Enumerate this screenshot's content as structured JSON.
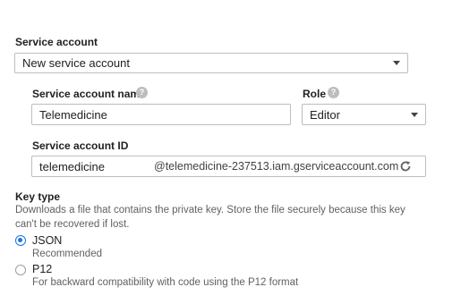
{
  "service_account": {
    "label": "Service account",
    "selected": "New service account"
  },
  "name_field": {
    "label": "Service account name",
    "value": "Telemedicine",
    "help_icon": "help-icon"
  },
  "role_field": {
    "label": "Role",
    "selected": "Editor",
    "help_icon": "help-icon"
  },
  "id_field": {
    "label": "Service account ID",
    "value": "telemedicine",
    "suffix": "@telemedicine-237513.iam.gserviceaccount.com",
    "refresh_icon": "refresh-icon"
  },
  "key_type": {
    "label": "Key type",
    "description": "Downloads a file that contains the private key. Store the file securely because this key can't be recovered if lost.",
    "options": [
      {
        "label": "JSON",
        "hint": "Recommended",
        "checked": true
      },
      {
        "label": "P12",
        "hint": "For backward compatibility with code using the P12 format",
        "checked": false
      }
    ]
  },
  "colors": {
    "accent": "#1a73e8",
    "border": "#bdbdbd",
    "text": "#212121",
    "secondary_text": "#616161"
  }
}
